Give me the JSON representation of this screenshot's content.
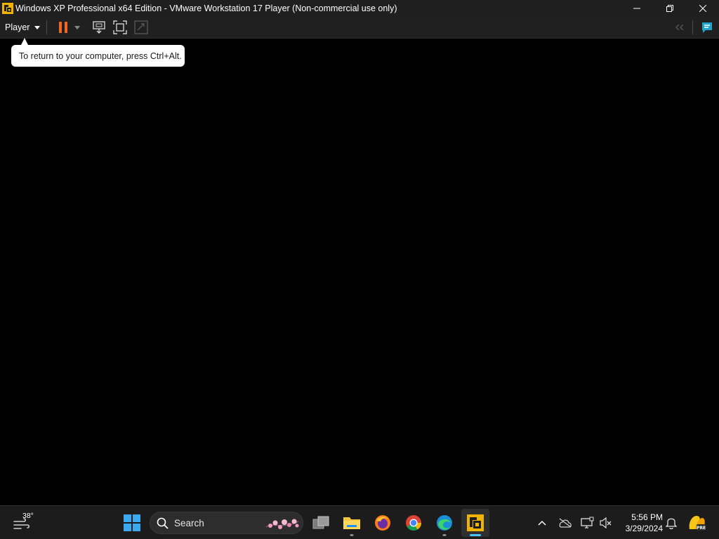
{
  "window": {
    "title": "Windows XP Professional x64 Edition - VMware Workstation 17 Player (Non-commercial use only)",
    "controls": [
      "minimize",
      "restore",
      "close"
    ]
  },
  "toolbar": {
    "player_label": "Player",
    "icons": [
      "pause-icon",
      "send-ctrl-alt-del-icon",
      "fit-guest-icon",
      "unity-icon"
    ],
    "right_icons": [
      "collapse-toolbar-icon",
      "message-log-icon"
    ]
  },
  "tooltip": {
    "text": "To return to your computer, press Ctrl+Alt."
  },
  "taskbar": {
    "weather": {
      "temp": "38°"
    },
    "search": {
      "label": "Search"
    },
    "apps": [
      {
        "name": "task-view"
      },
      {
        "name": "file-explorer"
      },
      {
        "name": "firefox"
      },
      {
        "name": "chrome"
      },
      {
        "name": "edge"
      },
      {
        "name": "vmware-player"
      }
    ],
    "clock": {
      "time": "5:56 PM",
      "date": "3/29/2024"
    }
  },
  "colors": {
    "accent": "#4cc2ff",
    "pause": "#f26522",
    "vmware_yellow": "#f0b400"
  }
}
